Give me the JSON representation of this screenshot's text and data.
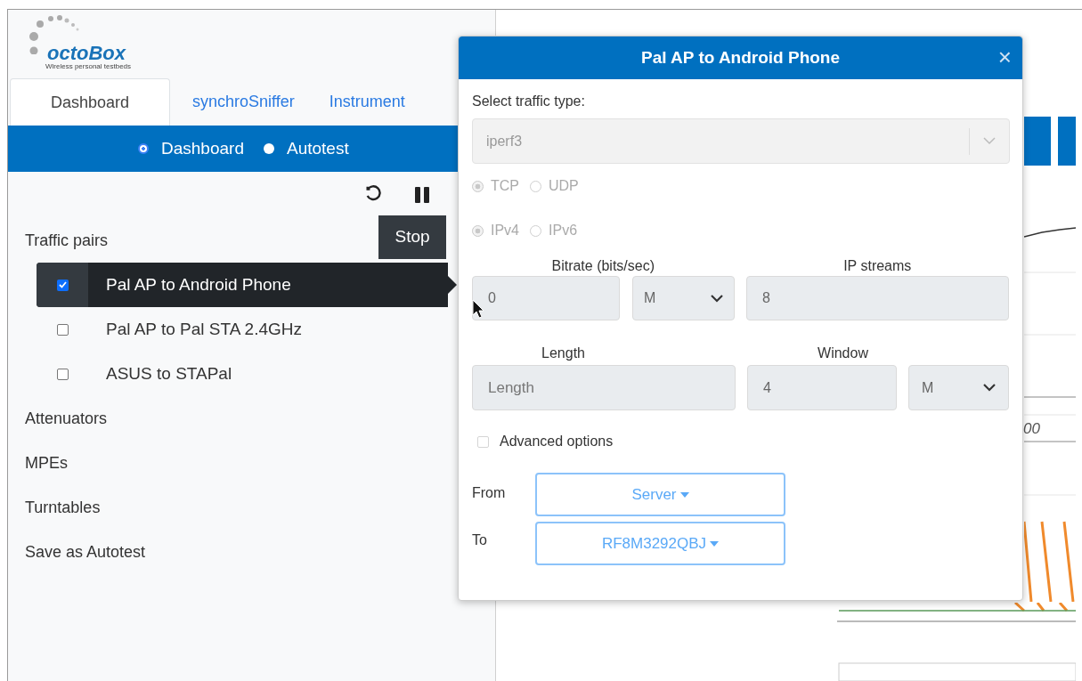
{
  "logo": {
    "name": "octoBox",
    "tagline": "Wireless personal testbeds"
  },
  "tabs": [
    {
      "label": "Dashboard",
      "selected": true
    },
    {
      "label": "synchroSniffer",
      "selected": false
    },
    {
      "label": "Instrument",
      "selected": false
    }
  ],
  "mode_switch": [
    {
      "label": "Dashboard",
      "selected": true
    },
    {
      "label": "Autotest",
      "selected": false
    }
  ],
  "tooltip": "Stop",
  "sidebar": {
    "heading": "Traffic pairs",
    "pairs": [
      {
        "label": "Pal AP to Android Phone",
        "checked": true,
        "selected": true
      },
      {
        "label": "Pal AP to Pal STA 2.4GHz",
        "checked": false,
        "selected": false
      },
      {
        "label": "ASUS to STAPal",
        "checked": false,
        "selected": false
      }
    ],
    "sections": [
      "Attenuators",
      "MPEs",
      "Turntables",
      "Save as Autotest"
    ]
  },
  "chart_fragment": {
    "tick_label": "00"
  },
  "dialog": {
    "title": "Pal AP to Android Phone",
    "close": "×",
    "traffic_type": {
      "label": "Select traffic type:",
      "value": "iperf3"
    },
    "protocol": [
      {
        "label": "TCP",
        "selected": true
      },
      {
        "label": "UDP",
        "selected": false
      }
    ],
    "ip_version": [
      {
        "label": "IPv4",
        "selected": true
      },
      {
        "label": "IPv6",
        "selected": false
      }
    ],
    "bitrate": {
      "label": "Bitrate (bits/sec)",
      "value": "0",
      "unit": "M"
    },
    "ip_streams": {
      "label": "IP streams",
      "value": "8"
    },
    "length": {
      "label": "Length",
      "placeholder": "Length"
    },
    "window": {
      "label": "Window",
      "value": "4",
      "unit": "M"
    },
    "advanced_options": {
      "label": "Advanced options",
      "checked": false
    },
    "from": {
      "label": "From",
      "value": "Server"
    },
    "to": {
      "label": "To",
      "value": "RF8M3292QBJ"
    }
  }
}
